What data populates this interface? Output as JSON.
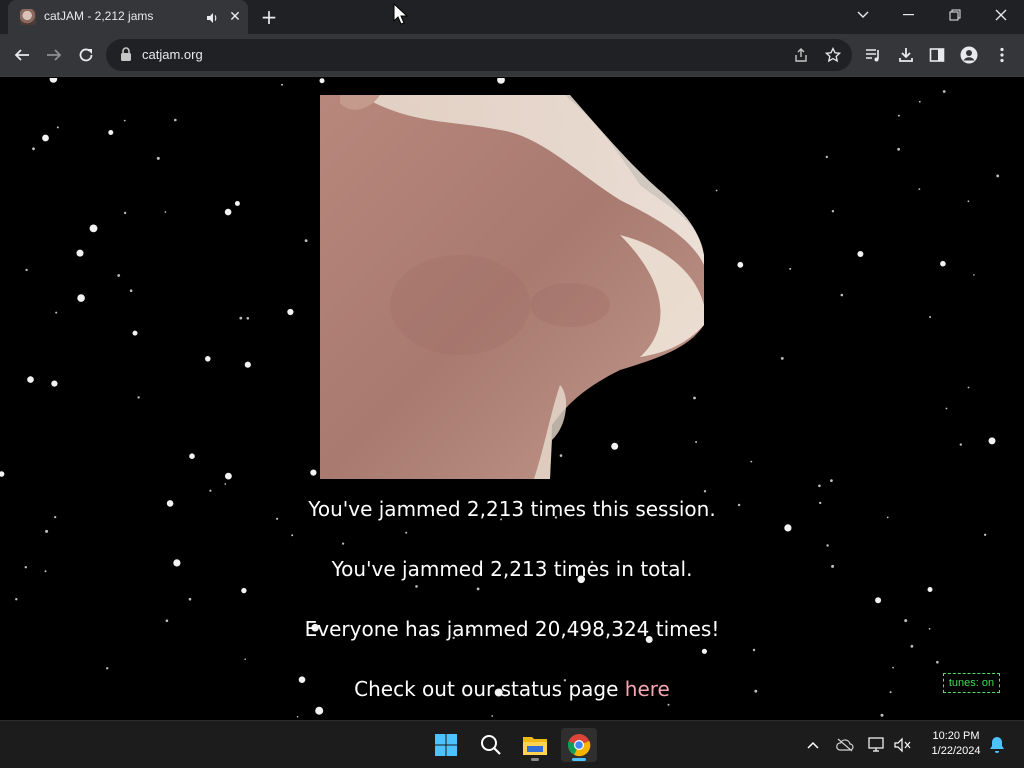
{
  "browser": {
    "tab_title": "catJAM - 2,212 jams",
    "url": "catjam.org"
  },
  "page": {
    "session_line": "You've jammed 2,213 times this session.",
    "total_line": "You've jammed 2,213 times in total.",
    "everyone_line": "Everyone has jammed 20,498,324 times!",
    "status_prefix": "Check out our status page ",
    "status_link": "here",
    "tunes_label": "tunes: on"
  },
  "taskbar": {
    "time": "10:20 PM",
    "date": "1/22/2024"
  },
  "colors": {
    "chrome_dark": "#202124",
    "chrome_toolbar": "#35363a",
    "link": "#f4a7b0",
    "tunes_green": "#3fdc54",
    "taskbar_accent": "#4cc2ff"
  },
  "icons": [
    "tab-favicon-icon",
    "speaker-icon",
    "close-icon",
    "plus-icon",
    "chevron-down-icon",
    "minimize-icon",
    "restore-icon",
    "window-close-icon",
    "back-arrow-icon",
    "forward-arrow-icon",
    "reload-icon",
    "lock-icon",
    "share-icon",
    "star-icon",
    "media-queue-icon",
    "download-icon",
    "side-panel-icon",
    "profile-icon",
    "menu-dots-icon",
    "windows-start-icon",
    "search-icon",
    "file-explorer-icon",
    "chrome-icon",
    "chevron-up-icon",
    "cloud-off-icon",
    "network-icon",
    "volume-muted-icon",
    "notification-bell-icon"
  ]
}
